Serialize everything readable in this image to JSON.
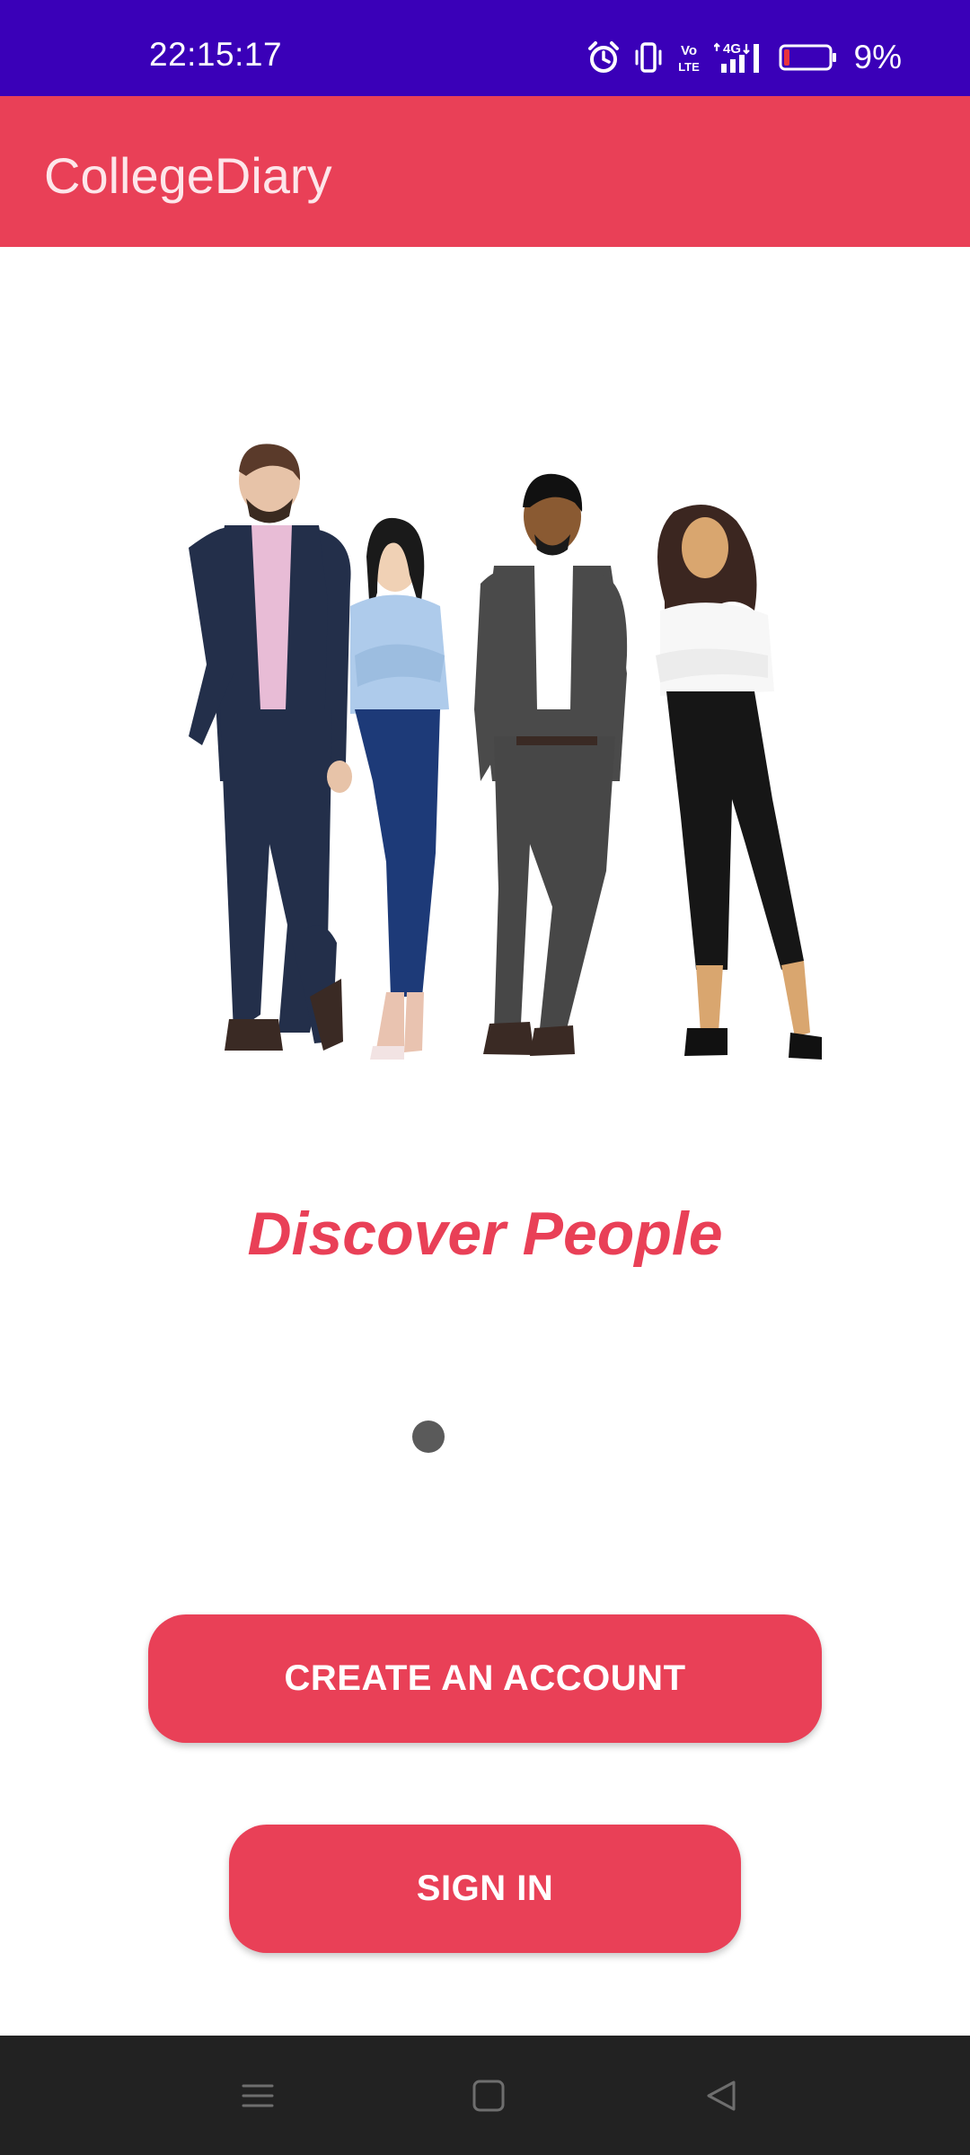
{
  "status_bar": {
    "time": "22:15:17",
    "battery_percent": "9%",
    "network": "4G",
    "volte": "Vo LTE",
    "icons": [
      "alarm-icon",
      "vibrate-icon",
      "volte-icon",
      "signal-icon",
      "battery-icon"
    ],
    "battery_level": 0.09,
    "background_color": "#3a00b8"
  },
  "app_bar": {
    "title": "CollegeDiary",
    "background_color": "#e94057"
  },
  "onboarding": {
    "illustration": "four-people-standing-illustration",
    "headline": "Discover People",
    "page_indicator": {
      "total": 1,
      "active": 1
    }
  },
  "actions": {
    "create_account_label": "CREATE AN ACCOUNT",
    "sign_in_label": "SIGN IN"
  },
  "nav_bar": {
    "icons": [
      "menu-icon",
      "home-icon",
      "back-icon"
    ]
  },
  "colors": {
    "accent": "#e94057",
    "status_bar": "#3a00b8",
    "nav_bar": "#222222",
    "indicator": "#5a5a5a"
  }
}
